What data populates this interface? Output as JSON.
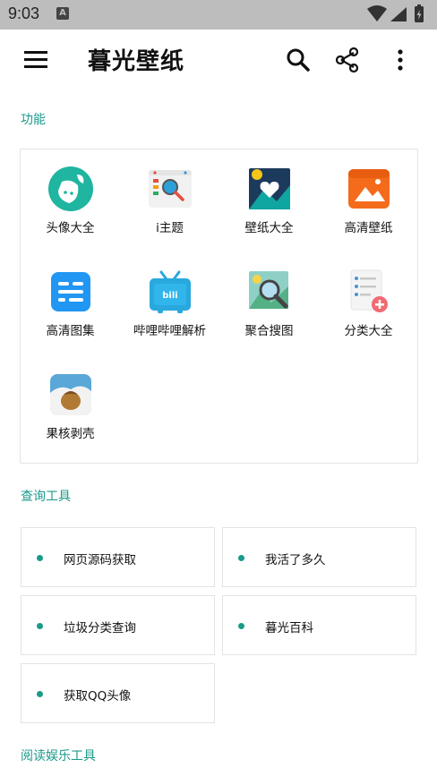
{
  "status_bar": {
    "time": "9:03",
    "notification_letter": "A"
  },
  "app_bar": {
    "title": "暮光壁纸"
  },
  "sections": {
    "features": "功能",
    "query_tools": "查询工具",
    "reading_tools": "阅读娱乐工具"
  },
  "features": [
    {
      "label": "头像大全",
      "icon": "avatar-icon"
    },
    {
      "label": "i主题",
      "icon": "theme-icon"
    },
    {
      "label": "壁纸大全",
      "icon": "wallpaper-icon"
    },
    {
      "label": "高清壁纸",
      "icon": "hd-wallpaper-icon"
    },
    {
      "label": "高清图集",
      "icon": "gallery-icon"
    },
    {
      "label": "哔哩哔哩解析",
      "icon": "bilibili-icon"
    },
    {
      "label": "聚合搜图",
      "icon": "image-search-icon"
    },
    {
      "label": "分类大全",
      "icon": "category-icon"
    },
    {
      "label": "果核剥壳",
      "icon": "nut-icon"
    }
  ],
  "query_tools": [
    {
      "label": "网页源码获取"
    },
    {
      "label": "我活了多久"
    },
    {
      "label": "垃圾分类查询"
    },
    {
      "label": "暮光百科"
    },
    {
      "label": "获取QQ头像"
    }
  ],
  "colors": {
    "accent": "#1a9a8a",
    "status_bar": "#bdbdbd"
  }
}
